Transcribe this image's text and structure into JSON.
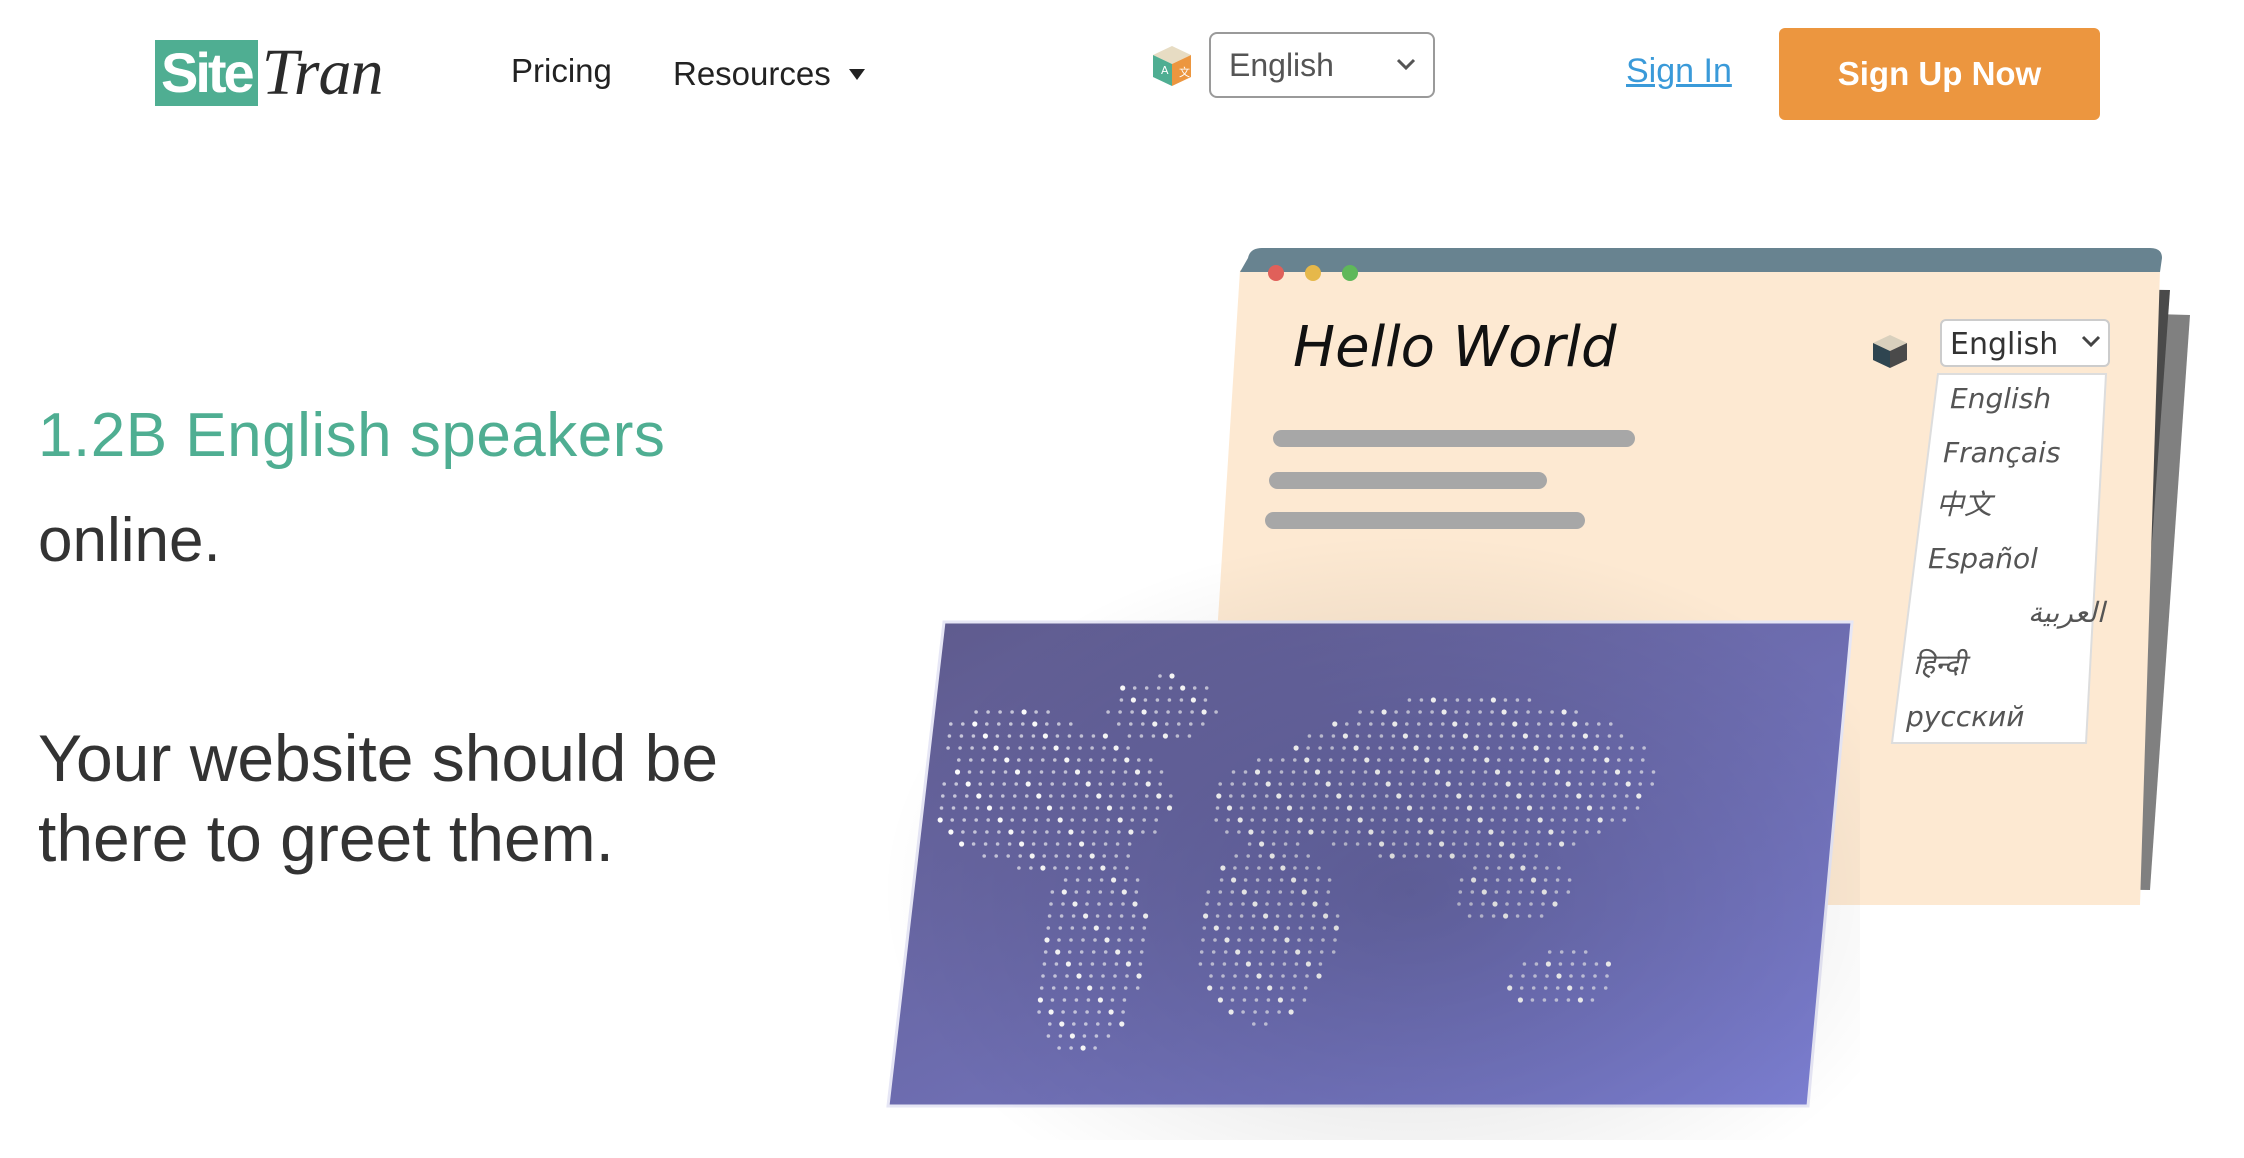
{
  "header": {
    "logo_part1": "Site",
    "logo_part2": "Tran",
    "nav": {
      "pricing": "Pricing",
      "resources": "Resources"
    },
    "language_select": {
      "value": "English"
    },
    "sign_in": "Sign In",
    "sign_up": "Sign Up Now"
  },
  "hero": {
    "line1": "1.2B English speakers",
    "line2": "online.",
    "tagline": "Your website should be there to greet them."
  },
  "illustration": {
    "hello_text": "Hello World",
    "selected_language": "English",
    "language_options": [
      "English",
      "Français",
      "中文",
      "Español",
      "العربية",
      "हिन्दी",
      "русский"
    ],
    "window_dots": [
      "#e0605a",
      "#e6b84a",
      "#5fb85a"
    ]
  },
  "colors": {
    "brand_green": "#4fae92",
    "cta_orange": "#ec963f",
    "link_blue": "#3a9ad9",
    "browser_bg": "#fde9d2",
    "browser_bar": "#688390",
    "map_start": "#5e5a8c",
    "map_end": "#7c7fd3"
  }
}
